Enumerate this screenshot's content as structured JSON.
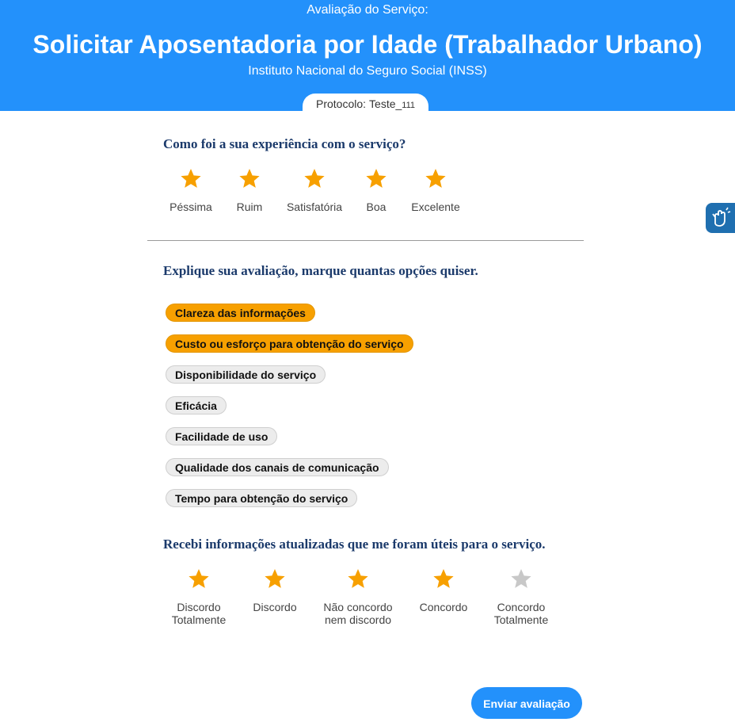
{
  "header": {
    "eyebrow": "Avaliação do Serviço:",
    "title": "Solicitar Aposentadoria por Idade (Trabalhador Urbano)",
    "org": "Instituto Nacional do Seguro Social (INSS)"
  },
  "protocol": {
    "label": "Protocolo:",
    "value": "Teste_",
    "suffix": "111"
  },
  "q1": {
    "text": "Como foi a sua experiência com o serviço?",
    "options": [
      {
        "label": "Péssima",
        "filled": true
      },
      {
        "label": "Ruim",
        "filled": true
      },
      {
        "label": "Satisfatória",
        "filled": true
      },
      {
        "label": "Boa",
        "filled": true
      },
      {
        "label": "Excelente",
        "filled": true
      }
    ]
  },
  "q2": {
    "text": "Explique sua avaliação, marque quantas opções quiser.",
    "chips": [
      {
        "label": "Clareza das informações",
        "selected": true
      },
      {
        "label": "Custo ou esforço para obtenção do serviço",
        "selected": true
      },
      {
        "label": "Disponibilidade do serviço",
        "selected": false
      },
      {
        "label": "Eficácia",
        "selected": false
      },
      {
        "label": "Facilidade de uso",
        "selected": false
      },
      {
        "label": "Qualidade dos canais de comunicação",
        "selected": false
      },
      {
        "label": "Tempo para obtenção do serviço",
        "selected": false
      }
    ]
  },
  "q3": {
    "text": "Recebi informações atualizadas que me foram úteis para o serviço.",
    "options": [
      {
        "label_1": "Discordo",
        "label_2": "Totalmente",
        "filled": true
      },
      {
        "label_1": "Discordo",
        "label_2": "",
        "filled": true
      },
      {
        "label_1": "Não concordo",
        "label_2": "nem discordo",
        "filled": true
      },
      {
        "label_1": "Concordo",
        "label_2": "",
        "filled": true
      },
      {
        "label_1": "Concordo",
        "label_2": "Totalmente",
        "filled": false
      }
    ]
  },
  "submit": {
    "label": "Enviar avaliação"
  },
  "colors": {
    "primary": "#2391fb",
    "star_on": "#f7a000",
    "star_off": "#c8c8c8",
    "chip_on": "#f7a000",
    "question": "#1b3a6b"
  },
  "icons": {
    "star": "star-icon",
    "accessibility": "sign-language-hand-icon"
  }
}
